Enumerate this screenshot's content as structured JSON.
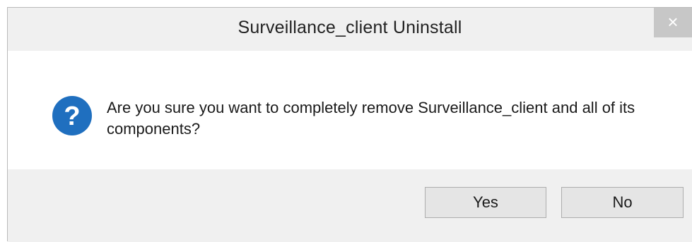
{
  "window": {
    "title": "Surveillance_client Uninstall",
    "close_label": "×"
  },
  "message": {
    "icon": "question-icon",
    "text": "Are you sure you want to completely remove Surveillance_client and all of its components?"
  },
  "buttons": {
    "yes_label": "Yes",
    "no_label": "No"
  },
  "colors": {
    "icon_blue": "#1f6fbf",
    "close_bg": "#c7c7c7",
    "chrome_bg": "#f0f0f0"
  }
}
